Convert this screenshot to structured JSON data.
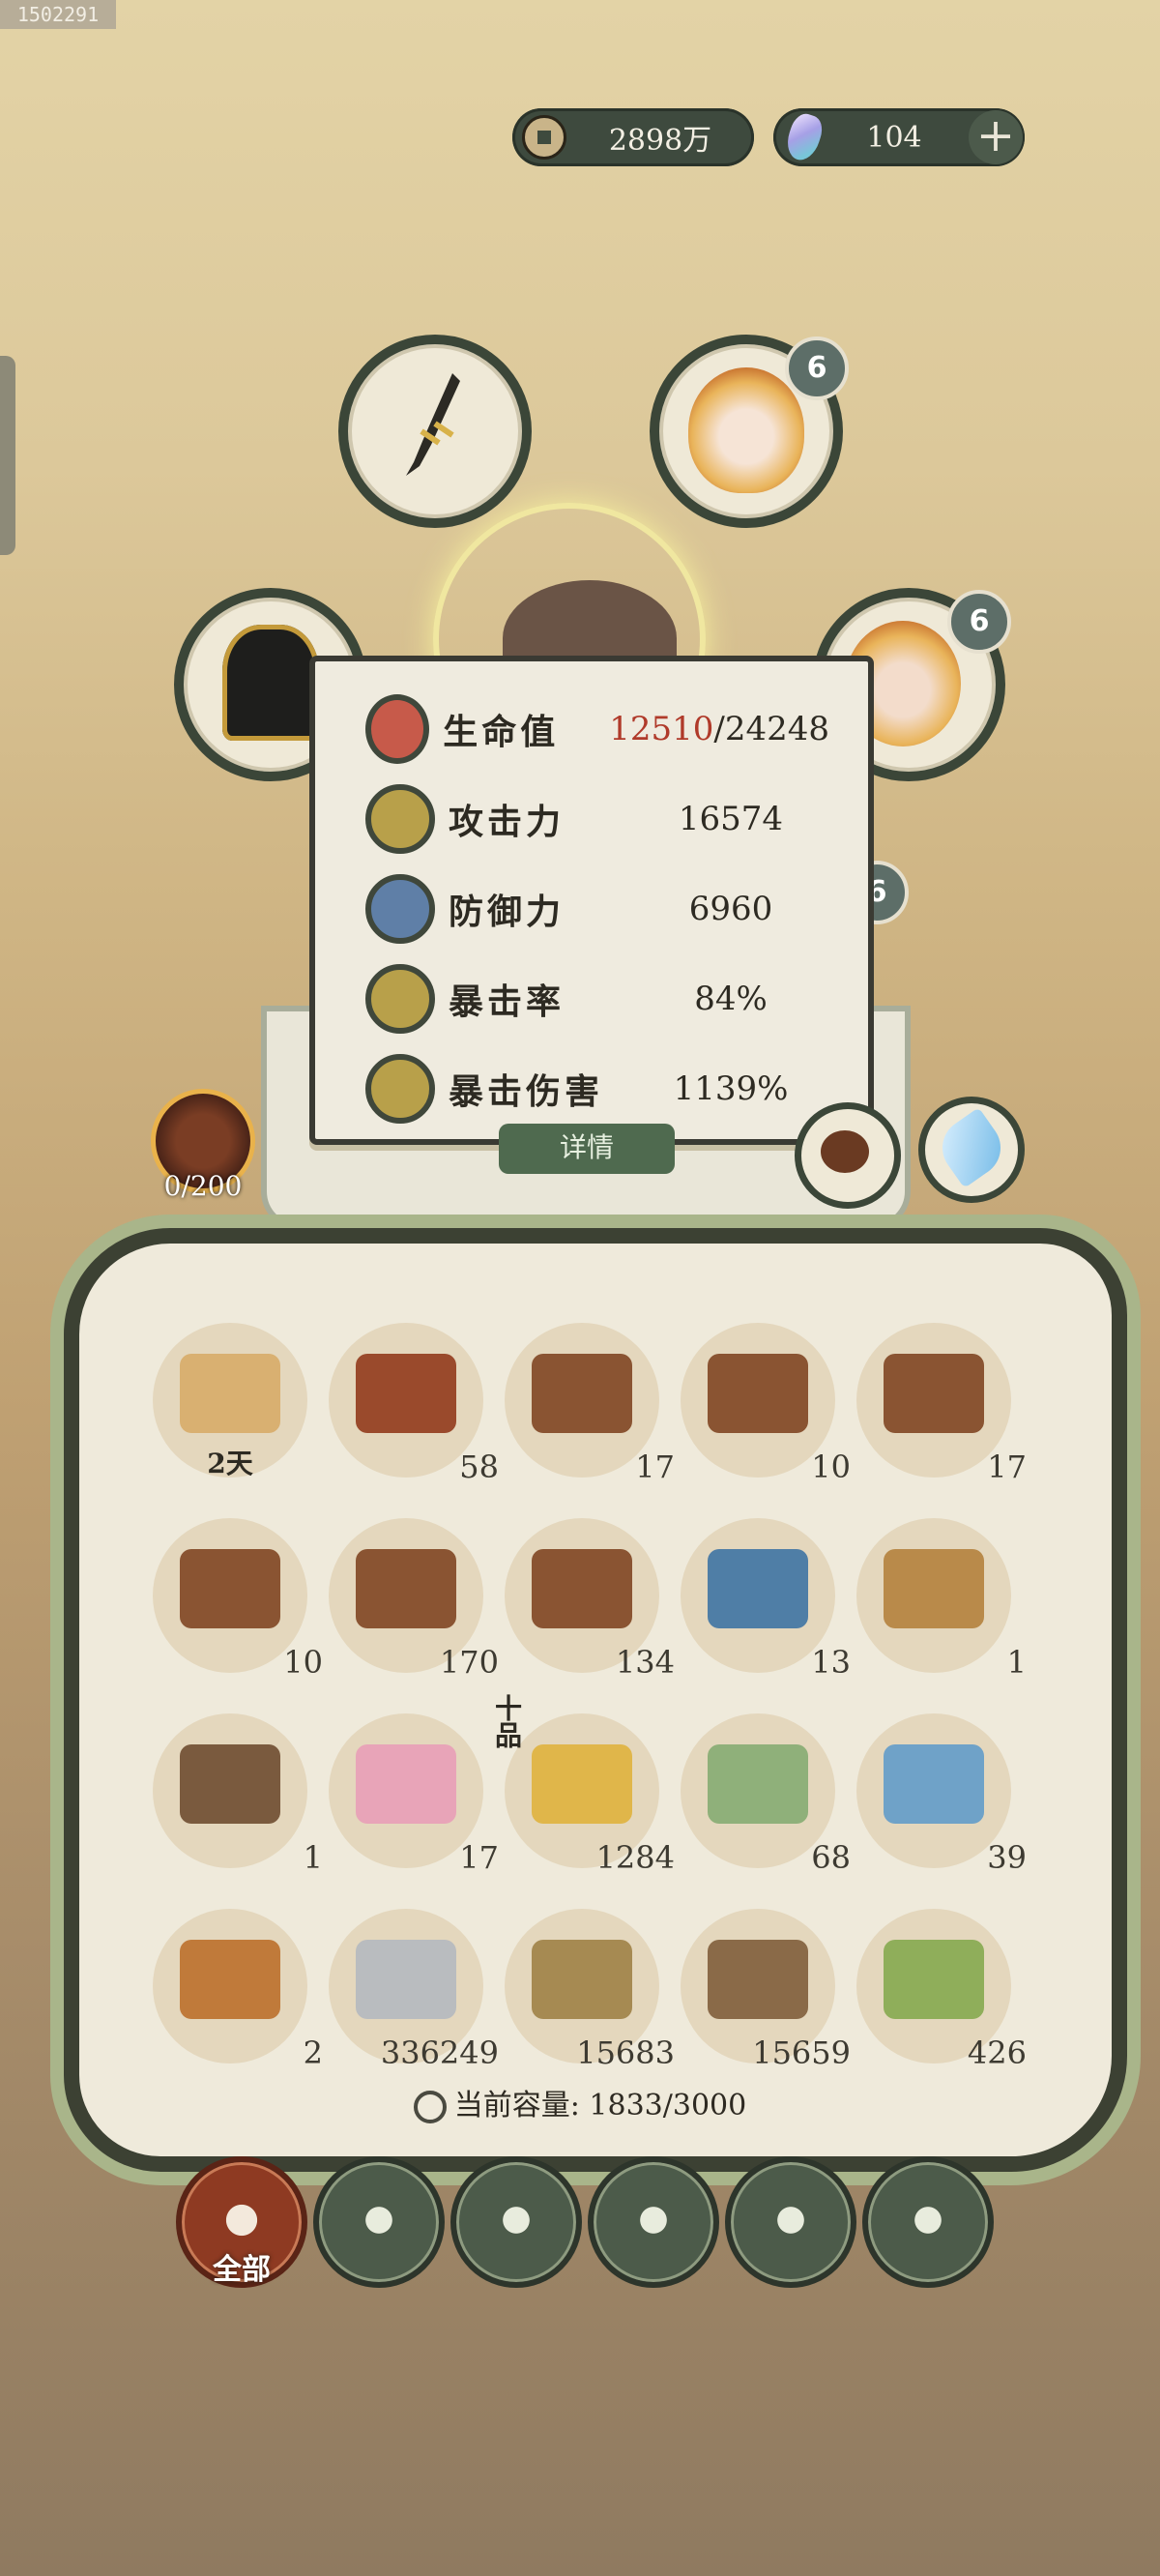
{
  "watermark_id": "1502291",
  "currency": {
    "coins": "2898万",
    "gems": "104"
  },
  "equipment_badges": {
    "top_right": "6",
    "mid_right": "6",
    "lower_right": "6"
  },
  "stats": [
    {
      "icon": "heart-icon",
      "label": "生命值",
      "current": "12510",
      "max": "/24248",
      "color": "#c75a4a"
    },
    {
      "icon": "sword-icon",
      "label": "攻击力",
      "value": "16574",
      "color": "#b8a04a"
    },
    {
      "icon": "shield-figure-icon",
      "label": "防御力",
      "value": "6960",
      "color": "#5f7fa7"
    },
    {
      "icon": "crit-burst-icon",
      "label": "暴击率",
      "value": "84%",
      "color": "#b8a04a"
    },
    {
      "icon": "crit-damage-icon",
      "label": "暴击伤害",
      "value": "1139%",
      "color": "#b8a04a"
    }
  ],
  "details_button": "详情",
  "token": {
    "count": "0/200"
  },
  "inventory": [
    {
      "icon": "scroll-icon",
      "label": "2天",
      "color": "#d9b071"
    },
    {
      "icon": "treasure-chest-icon",
      "count": "58",
      "color": "#9a4a2c"
    },
    {
      "icon": "treasure-chest-icon",
      "count": "17",
      "color": "#8a5432"
    },
    {
      "icon": "treasure-chest-icon",
      "count": "10",
      "color": "#8a5432"
    },
    {
      "icon": "treasure-chest-icon",
      "count": "17",
      "color": "#8a5432"
    },
    {
      "icon": "treasure-chest-icon",
      "count": "10",
      "color": "#8a5432"
    },
    {
      "icon": "treasure-chest-icon",
      "count": "170",
      "color": "#8a5432"
    },
    {
      "icon": "treasure-chest-icon",
      "count": "134",
      "color": "#8a5432"
    },
    {
      "icon": "blue-chest-icon",
      "count": "13",
      "color": "#4f7ea6"
    },
    {
      "icon": "cloth-bag-icon",
      "count": "1",
      "color": "#b98a4a"
    },
    {
      "icon": "incense-tray-icon",
      "count": "1",
      "color": "#7a5a3e"
    },
    {
      "icon": "lotus-icon",
      "count": "17",
      "color": "#e8a4b8"
    },
    {
      "icon": "golden-fruit-icon",
      "count": "1284",
      "tag": "十品",
      "color": "#e0b64a"
    },
    {
      "icon": "green-bag-icon",
      "count": "68",
      "color": "#8fb07a"
    },
    {
      "icon": "blue-bag-icon",
      "count": "39",
      "color": "#6fa2c8"
    },
    {
      "icon": "token-plaque-icon",
      "count": "2",
      "color": "#c07a3a"
    },
    {
      "icon": "stone-icon",
      "count": "336249",
      "color": "#b9bcbf"
    },
    {
      "icon": "straw-icon",
      "count": "15683",
      "color": "#a68a52"
    },
    {
      "icon": "log-icon",
      "count": "15659",
      "color": "#8a6a48"
    },
    {
      "icon": "bamboo-icon",
      "count": "426",
      "color": "#8fae5a"
    }
  ],
  "capacity": "当前容量: 1833/3000",
  "categories": [
    {
      "icon": "all-grid-icon",
      "label": "全部",
      "active": true
    },
    {
      "icon": "log-category-icon",
      "label": "",
      "active": false
    },
    {
      "icon": "herb-icon",
      "label": "",
      "active": false
    },
    {
      "icon": "food-bowl-icon",
      "label": "",
      "active": false
    },
    {
      "icon": "ore-icon",
      "label": "",
      "active": false
    },
    {
      "icon": "scroll-category-icon",
      "label": "",
      "active": false
    }
  ]
}
